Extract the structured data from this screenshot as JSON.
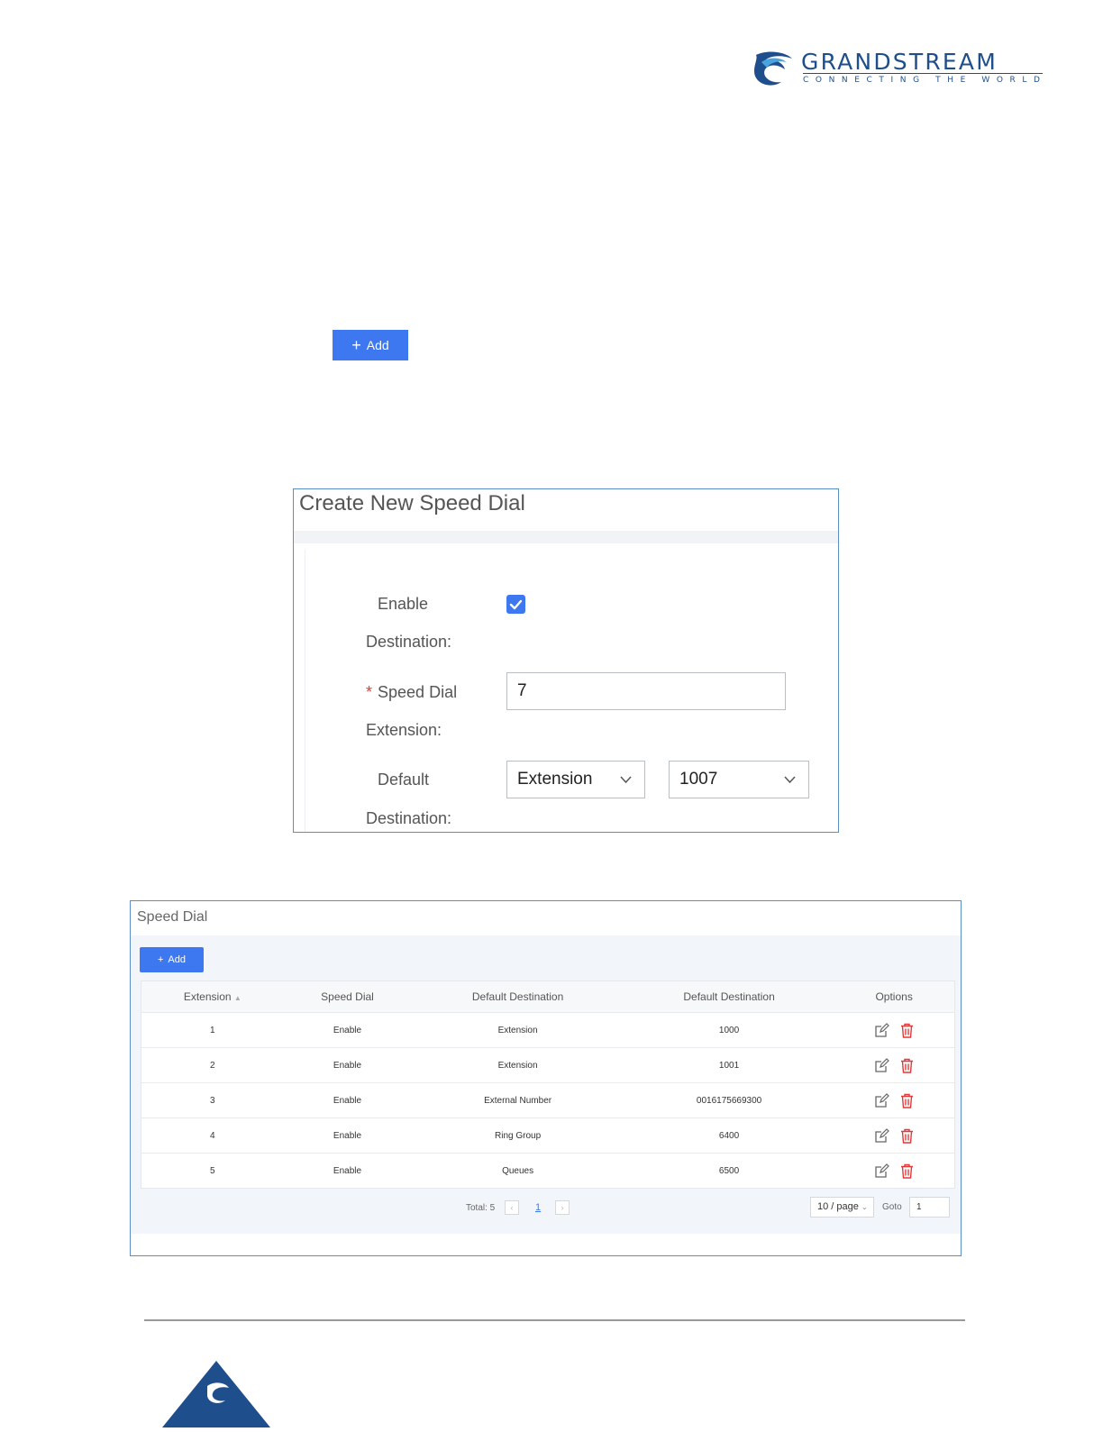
{
  "header": {
    "brand_name": "GRANDSTREAM",
    "brand_tagline": "CONNECTING THE WORLD",
    "brand_color": "#1f4e8c"
  },
  "add_button": {
    "label": "Add",
    "icon": "plus-icon"
  },
  "create_dialog": {
    "title": "Create New Speed Dial",
    "enable_destination_label_1": "Enable",
    "enable_destination_label_2": "Destination:",
    "enable_destination_checked": true,
    "speed_dial_required": "*",
    "speed_dial_label_1": "Speed Dial",
    "speed_dial_label_2": "Extension:",
    "speed_dial_value": "7",
    "default_destination_label_1": "Default",
    "default_destination_label_2": "Destination:",
    "destination_type_value": "Extension",
    "destination_value": "1007"
  },
  "speed_dial_panel": {
    "title": "Speed Dial",
    "add_label": "Add",
    "columns": [
      "Extension",
      "Speed Dial",
      "Default Destination",
      "Default Destination",
      "Options"
    ],
    "rows": [
      [
        "1",
        "Enable",
        "Extension",
        "1000"
      ],
      [
        "2",
        "Enable",
        "Extension",
        "1001"
      ],
      [
        "3",
        "Enable",
        "External Number",
        "0016175669300"
      ],
      [
        "4",
        "Enable",
        "Ring Group",
        "6400"
      ],
      [
        "5",
        "Enable",
        "Queues",
        "6500"
      ]
    ],
    "pagination": {
      "total": "Total: 5",
      "current_page": "1",
      "page_size": "10 / page",
      "goto_label": "Goto",
      "goto_value": "1"
    }
  },
  "colors": {
    "primary": "#3e78f0",
    "delete": "#e03a3a",
    "frame": "#5b8ec7"
  }
}
